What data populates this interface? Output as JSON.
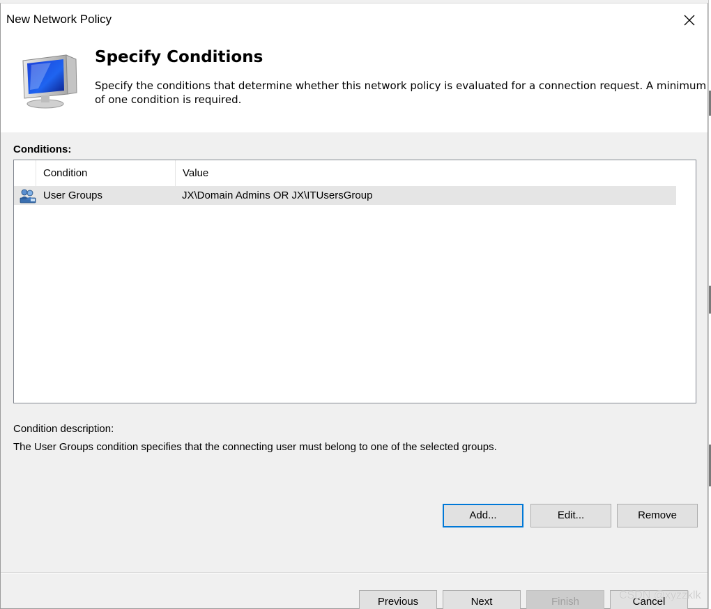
{
  "window": {
    "title": "New Network Policy"
  },
  "banner": {
    "title": "Specify Conditions",
    "description": "Specify the conditions that determine whether this network policy is evaluated for a connection request. A minimum of one condition is required."
  },
  "conditions": {
    "label": "Conditions:",
    "columns": [
      "Condition",
      "Value"
    ],
    "rows": [
      {
        "condition": "User Groups",
        "value": "JX\\Domain Admins OR JX\\ITUsersGroup",
        "icon": "user-group-icon"
      }
    ]
  },
  "description": {
    "label": "Condition description:",
    "text": "The User Groups condition specifies that the connecting user must belong to one of the selected groups."
  },
  "actions": {
    "add": "Add...",
    "edit": "Edit...",
    "remove": "Remove"
  },
  "footer": {
    "previous": "Previous",
    "next": "Next",
    "finish": "Finish",
    "cancel": "Cancel"
  },
  "watermark": "CSDN @xyzzklk",
  "colors": {
    "focus_border": "#0078d7",
    "selected_row": "#e5e5e5",
    "dialog_bg": "#f0f0f0"
  }
}
